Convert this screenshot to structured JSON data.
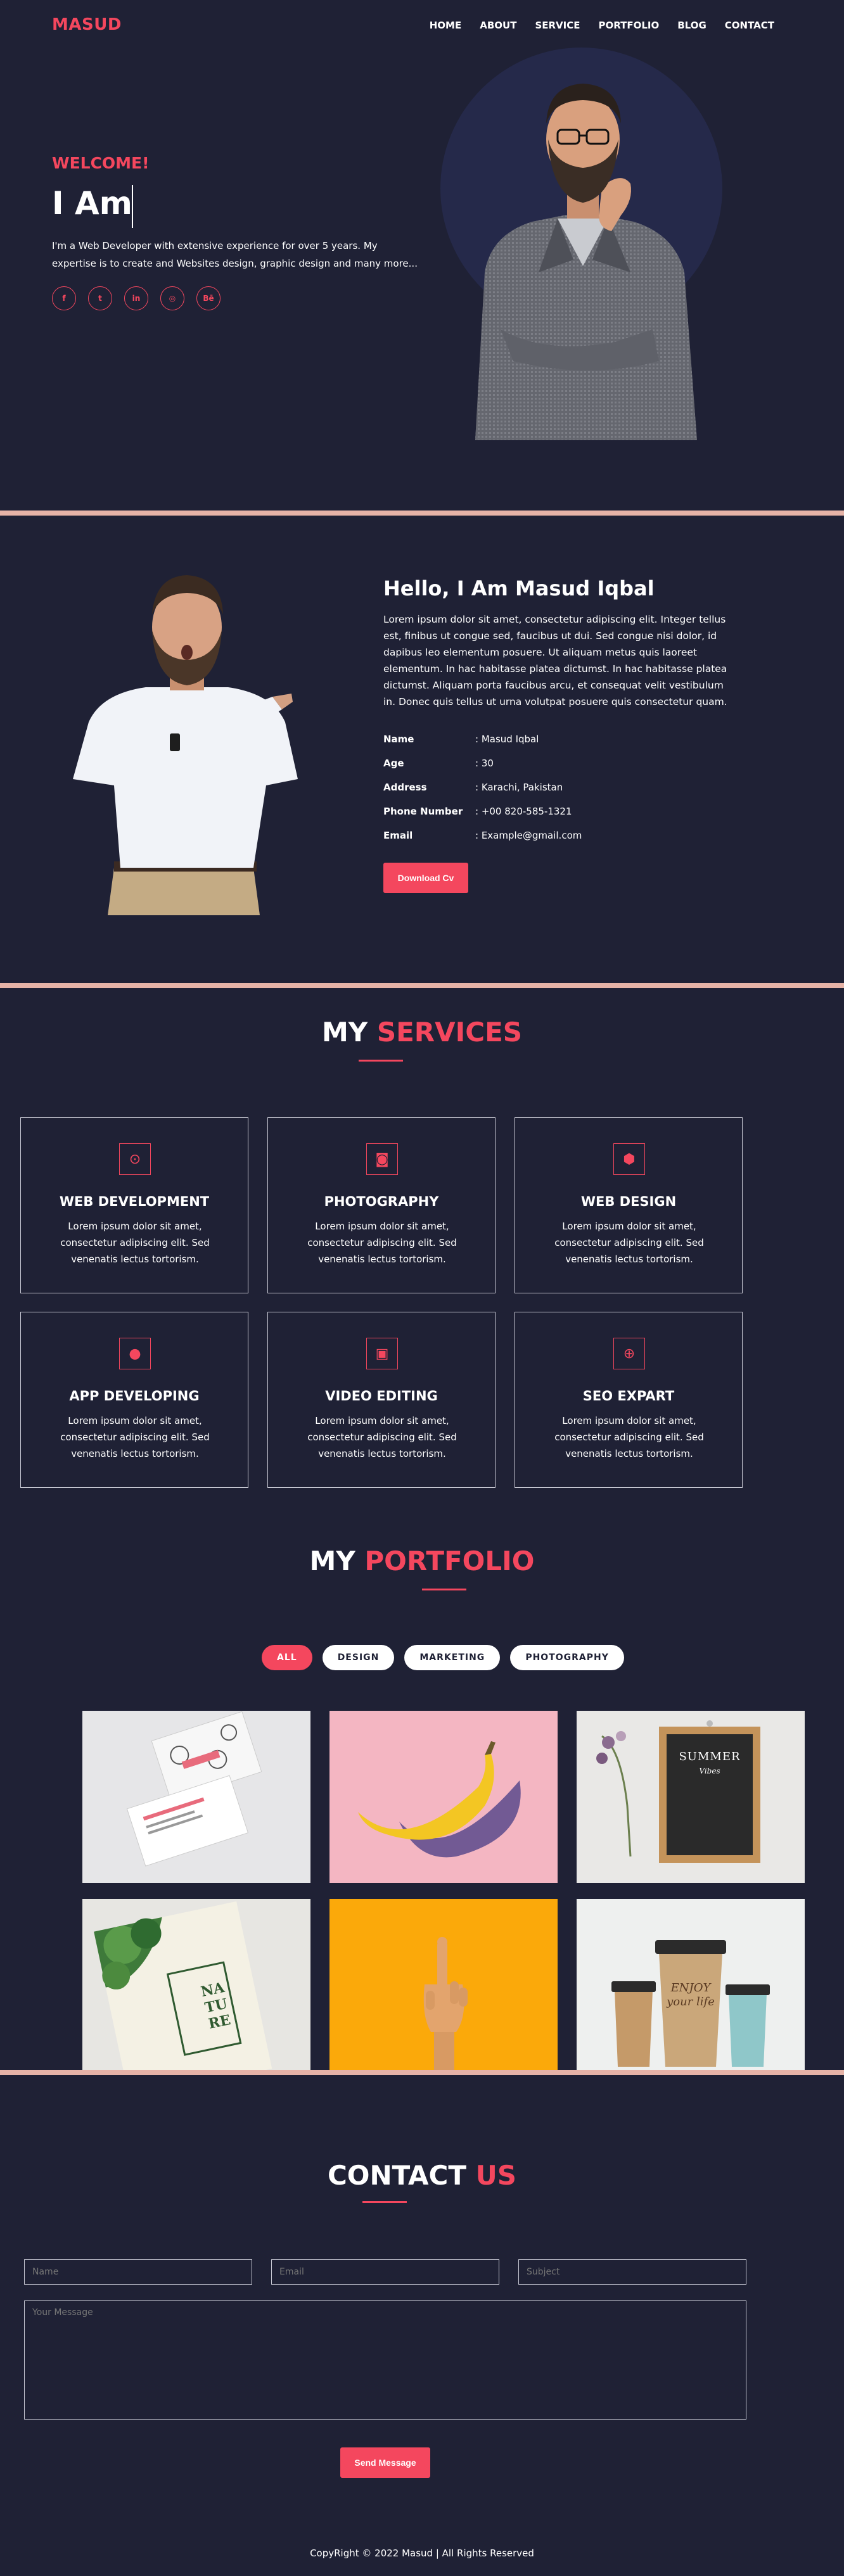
{
  "nav": {
    "logo": "MASUD",
    "items": [
      "HOME",
      "ABOUT",
      "SERVICE",
      "PORTFOLIO",
      "BLOG",
      "CONTACT"
    ]
  },
  "hero": {
    "welcome": "WELCOME!",
    "headline": "I Am",
    "description": "I'm a Web Developer with extensive experience for over 5 years. My expertise is to create and Websites design, graphic design and many more...",
    "socials": [
      "facebook-icon",
      "twitter-icon",
      "linkedin-icon",
      "instagram-icon",
      "behance-icon"
    ],
    "social_glyphs": [
      "f",
      "t",
      "in",
      "◎",
      "Bē"
    ]
  },
  "about": {
    "title": "Hello, I Am Masud Iqbal",
    "description": "Lorem ipsum dolor sit amet, consectetur adipiscing elit. Integer tellus est, finibus ut congue sed, faucibus ut dui. Sed congue nisi dolor, id dapibus leo elementum posuere. Ut aliquam metus quis laoreet elementum. In hac habitasse platea dictumst. In hac habitasse platea dictumst. Aliquam porta faucibus arcu, et consequat velit vestibulum in. Donec quis tellus ut urna volutpat posuere quis consectetur quam.",
    "info": [
      {
        "key": "Name",
        "value": ": Masud Iqbal"
      },
      {
        "key": "Age",
        "value": ": 30"
      },
      {
        "key": "Address",
        "value": ": Karachi, Pakistan"
      },
      {
        "key": "Phone Number",
        "value": ": +00 820-585-1321"
      },
      {
        "key": "Email",
        "value": ": Example@gmail.com"
      }
    ],
    "button": "Download Cv"
  },
  "services": {
    "title_white": "MY",
    "title_red": "SERVICES",
    "items": [
      {
        "icon": "github-icon",
        "glyph": "⊙",
        "title": "WEB DEVELOPMENT",
        "desc": "Lorem ipsum dolor sit amet, consectetur adipiscing elit. Sed venenatis lectus tortorism."
      },
      {
        "icon": "camera-icon",
        "glyph": "◙",
        "title": "PHOTOGRAPHY",
        "desc": "Lorem ipsum dolor sit amet, consectetur adipiscing elit. Sed venenatis lectus tortorism."
      },
      {
        "icon": "cube-icon",
        "glyph": "⬢",
        "title": "WEB DESIGN",
        "desc": "Lorem ipsum dolor sit amet, consectetur adipiscing elit. Sed venenatis lectus tortorism."
      },
      {
        "icon": "apple-icon",
        "glyph": "●",
        "title": "APP DEVELOPING",
        "desc": "Lorem ipsum dolor sit amet, consectetur adipiscing elit. Sed venenatis lectus tortorism."
      },
      {
        "icon": "video-file-icon",
        "glyph": "▣",
        "title": "VIDEO EDITING",
        "desc": "Lorem ipsum dolor sit amet, consectetur adipiscing elit. Sed venenatis lectus tortorism."
      },
      {
        "icon": "search-icon",
        "glyph": "⊕",
        "title": "SEO EXPART",
        "desc": "Lorem ipsum dolor sit amet, consectetur adipiscing elit. Sed venenatis lectus tortorism."
      }
    ]
  },
  "portfolio": {
    "title_white": "MY",
    "title_red": "PORTFOLIO",
    "filters": [
      "ALL",
      "DESIGN",
      "MARKETING",
      "PHOTOGRAPHY"
    ],
    "active_filter": "ALL",
    "summer_card": {
      "title": "SUMMER",
      "subtitle": "Vibes"
    },
    "nature_card": {
      "text": "NA TU RE"
    },
    "cup_text": "ENJOY your life"
  },
  "contact": {
    "title_white": "CONTACT",
    "title_red": "US",
    "name_placeholder": "Name",
    "email_placeholder": "Email",
    "subject_placeholder": "Subject",
    "message_placeholder": "Your Message",
    "button": "Send Message"
  },
  "footer": {
    "text": "CopyRight © 2022 Masud | All Rights Reserved"
  },
  "colors": {
    "bg": "#1f2135",
    "accent": "#f4475e",
    "divider": "#e6b3a7"
  }
}
